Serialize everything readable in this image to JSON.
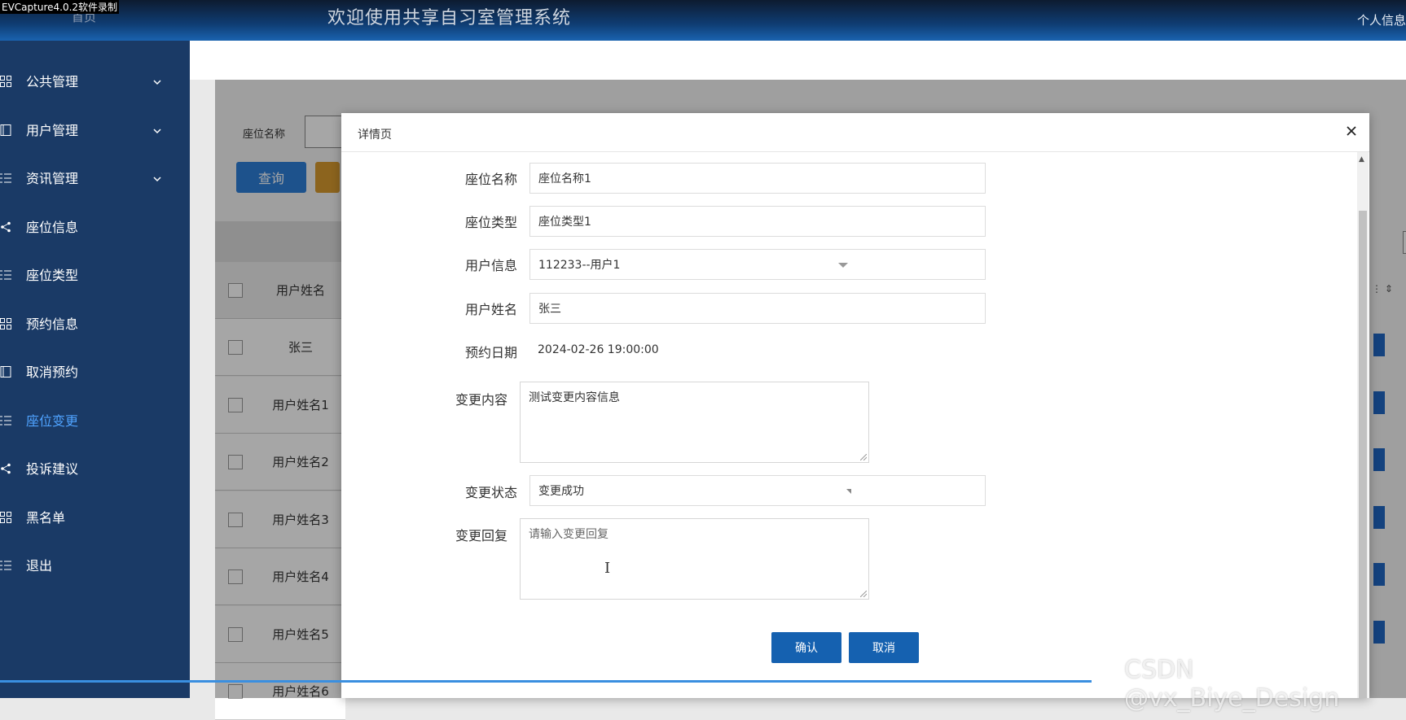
{
  "header": {
    "recorder_label": "EVCapture4.0.2软件录制",
    "home_label": "首页",
    "system_title": "欢迎使用共享自习室管理系统",
    "profile_label": "个人信息"
  },
  "sidebar": {
    "items": [
      {
        "label": "公共管理",
        "icon": "grid-icon",
        "has_chevron": true
      },
      {
        "label": "用户管理",
        "icon": "book-icon",
        "has_chevron": true
      },
      {
        "label": "资讯管理",
        "icon": "list-icon",
        "has_chevron": true
      },
      {
        "label": "座位信息",
        "icon": "share-icon",
        "has_chevron": false
      },
      {
        "label": "座位类型",
        "icon": "list-icon",
        "has_chevron": false
      },
      {
        "label": "预约信息",
        "icon": "grid-icon",
        "has_chevron": false
      },
      {
        "label": "取消预约",
        "icon": "book-icon",
        "has_chevron": false
      },
      {
        "label": "座位变更",
        "icon": "list-icon",
        "has_chevron": false,
        "active": true
      },
      {
        "label": "投诉建议",
        "icon": "share-icon",
        "has_chevron": false
      },
      {
        "label": "黑名单",
        "icon": "grid-icon",
        "has_chevron": false
      },
      {
        "label": "退出",
        "icon": "list-icon",
        "has_chevron": false
      }
    ],
    "active_color": "#4fa3ff"
  },
  "background_page": {
    "search_label": "座位名称",
    "query_button": "查询",
    "table_header_name": "用户姓名",
    "rows": [
      "张三",
      "用户姓名1",
      "用户姓名2",
      "用户姓名3",
      "用户姓名4",
      "用户姓名5",
      "用户姓名6"
    ]
  },
  "modal": {
    "title": "详情页",
    "fields": {
      "seat_name": {
        "label": "座位名称",
        "value": "座位名称1"
      },
      "seat_type": {
        "label": "座位类型",
        "value": "座位类型1"
      },
      "user_info": {
        "label": "用户信息",
        "value": "112233--用户1"
      },
      "user_name": {
        "label": "用户姓名",
        "value": "张三"
      },
      "booking_date": {
        "label": "预约日期",
        "value": "2024-02-26 19:00:00"
      },
      "change_content": {
        "label": "变更内容",
        "value": "测试变更内容信息"
      },
      "change_status": {
        "label": "变更状态",
        "value": "变更成功"
      },
      "change_reply": {
        "label": "变更回复",
        "placeholder": "请输入变更回复"
      }
    },
    "confirm_button": "确认",
    "cancel_button": "取消"
  },
  "watermark": "CSDN @vx_Biye_Design",
  "colors": {
    "sidebar_bg": "#1a3a66",
    "primary_button": "#1561b0",
    "query_button": "#2d7fd8"
  }
}
